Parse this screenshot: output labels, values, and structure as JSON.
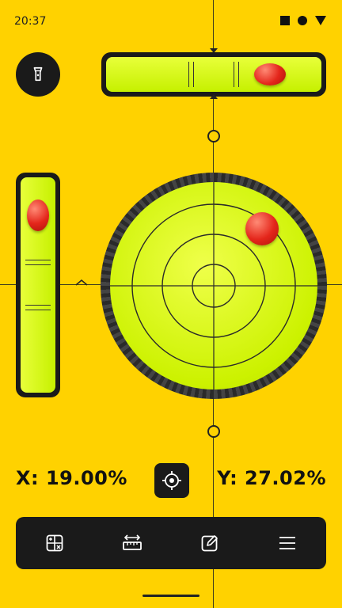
{
  "status": {
    "time": "20:37",
    "icons": [
      "square-icon",
      "circle-icon",
      "triangle-icon"
    ]
  },
  "levels": {
    "x_value": 0.19,
    "y_value": 0.2702
  },
  "readouts": {
    "x_text": "X: 19.00%",
    "y_text": "Y: 27.02%"
  },
  "toolbar": {
    "items": [
      "calculator-icon",
      "ruler-icon",
      "edit-icon",
      "menu-icon"
    ]
  },
  "colors": {
    "background": "#FFD200",
    "dark": "#1A1A1A",
    "level_fill": "#D4F500",
    "bubble": "#E4261B"
  }
}
